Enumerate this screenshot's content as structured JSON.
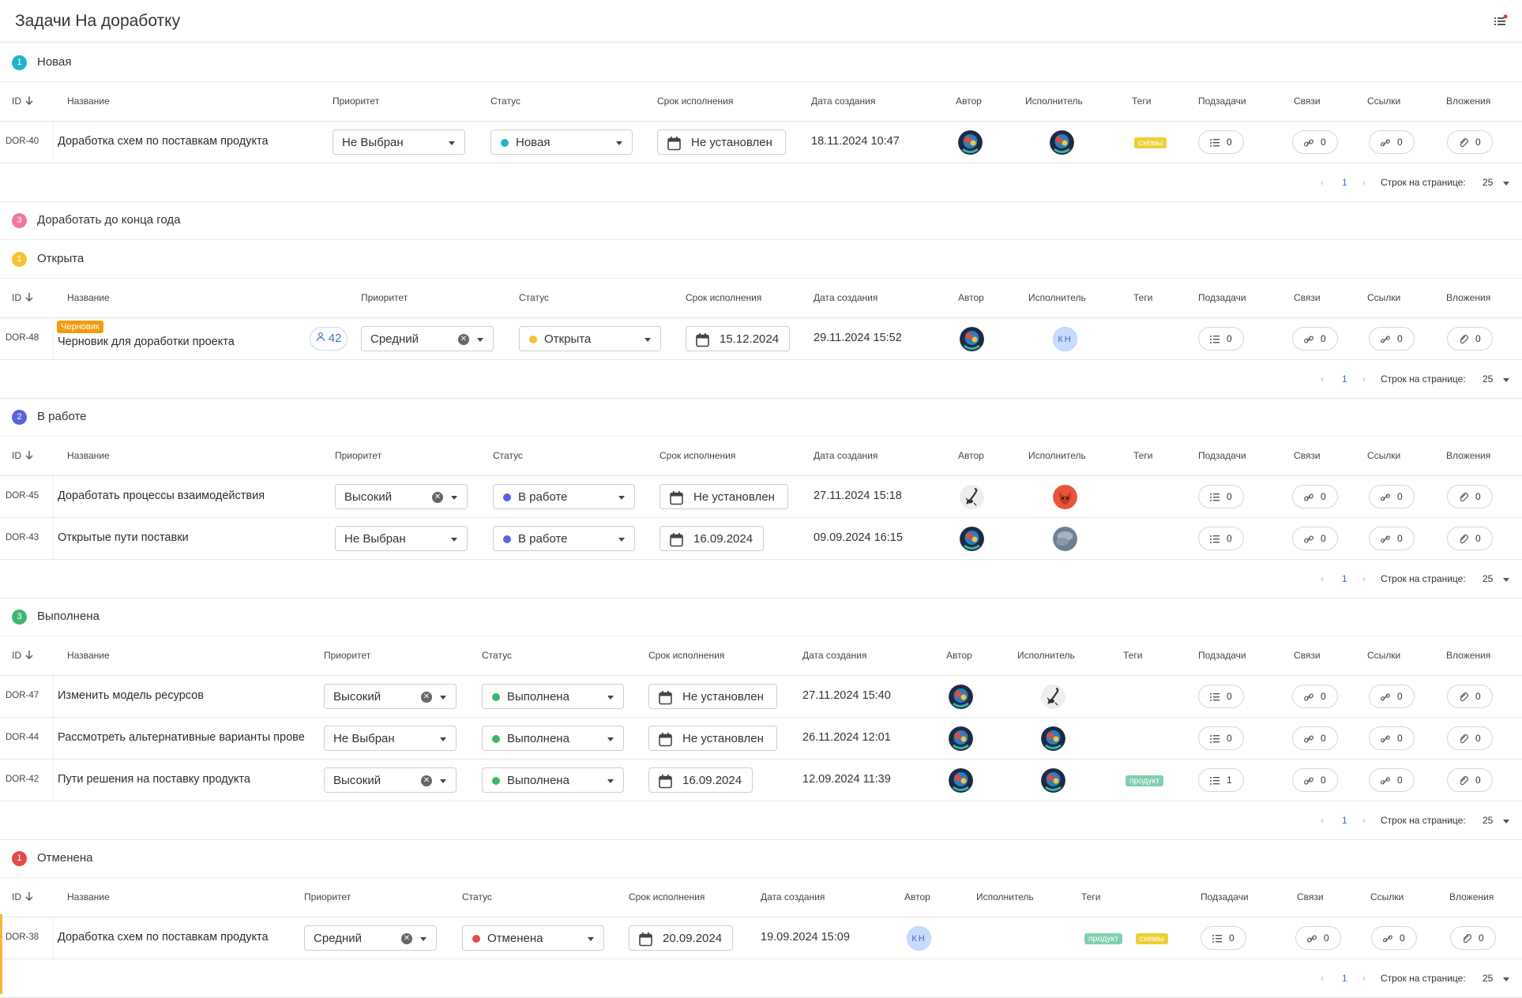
{
  "page": {
    "title": "Задачи На доработку"
  },
  "columns": {
    "id": "ID",
    "name": "Название",
    "priority": "Приоритет",
    "status": "Статус",
    "deadline": "Срок исполнения",
    "created": "Дата создания",
    "author": "Автор",
    "assignee": "Исполнитель",
    "tags": "Теги",
    "subtasks": "Подзадачи",
    "links": "Связи",
    "refs": "Ссылки",
    "attachments": "Вложения"
  },
  "pager": {
    "prev": "‹",
    "next": "›",
    "page": "1",
    "rows_label": "Строк на странице:",
    "rows_value": "25"
  },
  "colors": {
    "new": "#1fb5d1",
    "inwork": "#5a63d9",
    "open": "#f5c231",
    "done": "#3fb46e",
    "cancel": "#e44a4a",
    "backlog": "#ef7a9a",
    "tag_yellow": "#eed034",
    "tag_green": "#7fcfae",
    "draft": "#f29b0f"
  },
  "groups": [
    {
      "key": "new",
      "badge": "1",
      "title": "Новая",
      "color": "#1fb5d1",
      "rows": [
        {
          "id": "DOR-40",
          "name": "Доработка схем по поставкам продукта",
          "priority": "Не Выбран",
          "priority_clear": false,
          "status": "Новая",
          "status_color": "#1fb5d1",
          "deadline": "Не установлен",
          "created": "18.11.2024 10:47",
          "author": "robot",
          "assignee": "robot",
          "tags": [
            {
              "text": "схемы",
              "color": "#eed034"
            }
          ],
          "subtasks": "0",
          "links": "0",
          "refs": "0",
          "attachments": "0"
        }
      ]
    },
    {
      "key": "backlog",
      "badge": "3",
      "title": "Доработать до конца года",
      "color": "#ef7a9a",
      "collapsed": true,
      "rows": []
    },
    {
      "key": "open",
      "badge": "1",
      "title": "Открыта",
      "color": "#f5c231",
      "rows": [
        {
          "id": "DOR-48",
          "draft": "Черновик",
          "share": "42",
          "name": "Черновик для доработки проекта",
          "priority": "Средний",
          "priority_clear": true,
          "status": "Открыта",
          "status_color": "#f5c231",
          "deadline": "15.12.2024",
          "created": "29.11.2024 15:52",
          "author": "robot",
          "assignee": "КН",
          "tags": [],
          "subtasks": "0",
          "links": "0",
          "refs": "0",
          "attachments": "0"
        }
      ]
    },
    {
      "key": "inwork",
      "badge": "2",
      "title": "В работе",
      "color": "#5a63d9",
      "rows": [
        {
          "id": "DOR-45",
          "name": "Доработать процессы взаимодействия",
          "priority": "Высокий",
          "priority_clear": true,
          "status": "В работе",
          "status_color": "#5a63d9",
          "deadline": "Не установлен",
          "created": "27.11.2024 15:18",
          "author": "scorpion",
          "assignee": "fox",
          "tags": [],
          "subtasks": "0",
          "links": "0",
          "refs": "0",
          "attachments": "0"
        },
        {
          "id": "DOR-43",
          "name": "Открытые пути поставки",
          "priority": "Не Выбран",
          "priority_clear": false,
          "status": "В работе",
          "status_color": "#5a63d9",
          "deadline": "16.09.2024",
          "created": "09.09.2024 16:15",
          "author": "robot",
          "assignee": "cloud",
          "tags": [],
          "subtasks": "0",
          "links": "0",
          "refs": "0",
          "attachments": "0"
        }
      ]
    },
    {
      "key": "done",
      "badge": "3",
      "title": "Выполнена",
      "color": "#3fb46e",
      "rows": [
        {
          "id": "DOR-47",
          "name": "Изменить модель ресурсов",
          "priority": "Высокий",
          "priority_clear": true,
          "status": "Выполнена",
          "status_color": "#3fb46e",
          "deadline": "Не установлен",
          "created": "27.11.2024 15:40",
          "author": "robot",
          "assignee": "scorpion",
          "tags": [],
          "subtasks": "0",
          "links": "0",
          "refs": "0",
          "attachments": "0"
        },
        {
          "id": "DOR-44",
          "name": "Рассмотреть альтернативные варианты прове",
          "priority": "Не Выбран",
          "priority_clear": false,
          "status": "Выполнена",
          "status_color": "#3fb46e",
          "deadline": "Не установлен",
          "created": "26.11.2024 12:01",
          "author": "robot",
          "assignee": "robot",
          "tags": [],
          "subtasks": "0",
          "links": "0",
          "refs": "0",
          "attachments": "0"
        },
        {
          "id": "DOR-42",
          "name": "Пути решения на поставку продукта",
          "priority": "Высокий",
          "priority_clear": true,
          "status": "Выполнена",
          "status_color": "#3fb46e",
          "deadline": "16.09.2024",
          "created": "12.09.2024 11:39",
          "author": "robot",
          "assignee": "robot",
          "tags": [
            {
              "text": "продукт",
              "color": "#7fcfae"
            }
          ],
          "subtasks": "1",
          "links": "0",
          "refs": "0",
          "attachments": "0"
        }
      ]
    },
    {
      "key": "cancel",
      "badge": "1",
      "title": "Отменена",
      "color": "#e44a4a",
      "rows": [
        {
          "id": "DOR-38",
          "name": "Доработка схем по поставкам продукта",
          "priority": "Средний",
          "priority_clear": true,
          "status": "Отменена",
          "status_color": "#e44a4a",
          "deadline": "20.09.2024",
          "created": "19.09.2024 15:09",
          "author": "КН",
          "assignee": "",
          "tags": [
            {
              "text": "продукт",
              "color": "#7fcfae"
            },
            {
              "text": "схемы",
              "color": "#eed034"
            }
          ],
          "subtasks": "0",
          "links": "0",
          "refs": "0",
          "attachments": "0"
        }
      ]
    }
  ]
}
